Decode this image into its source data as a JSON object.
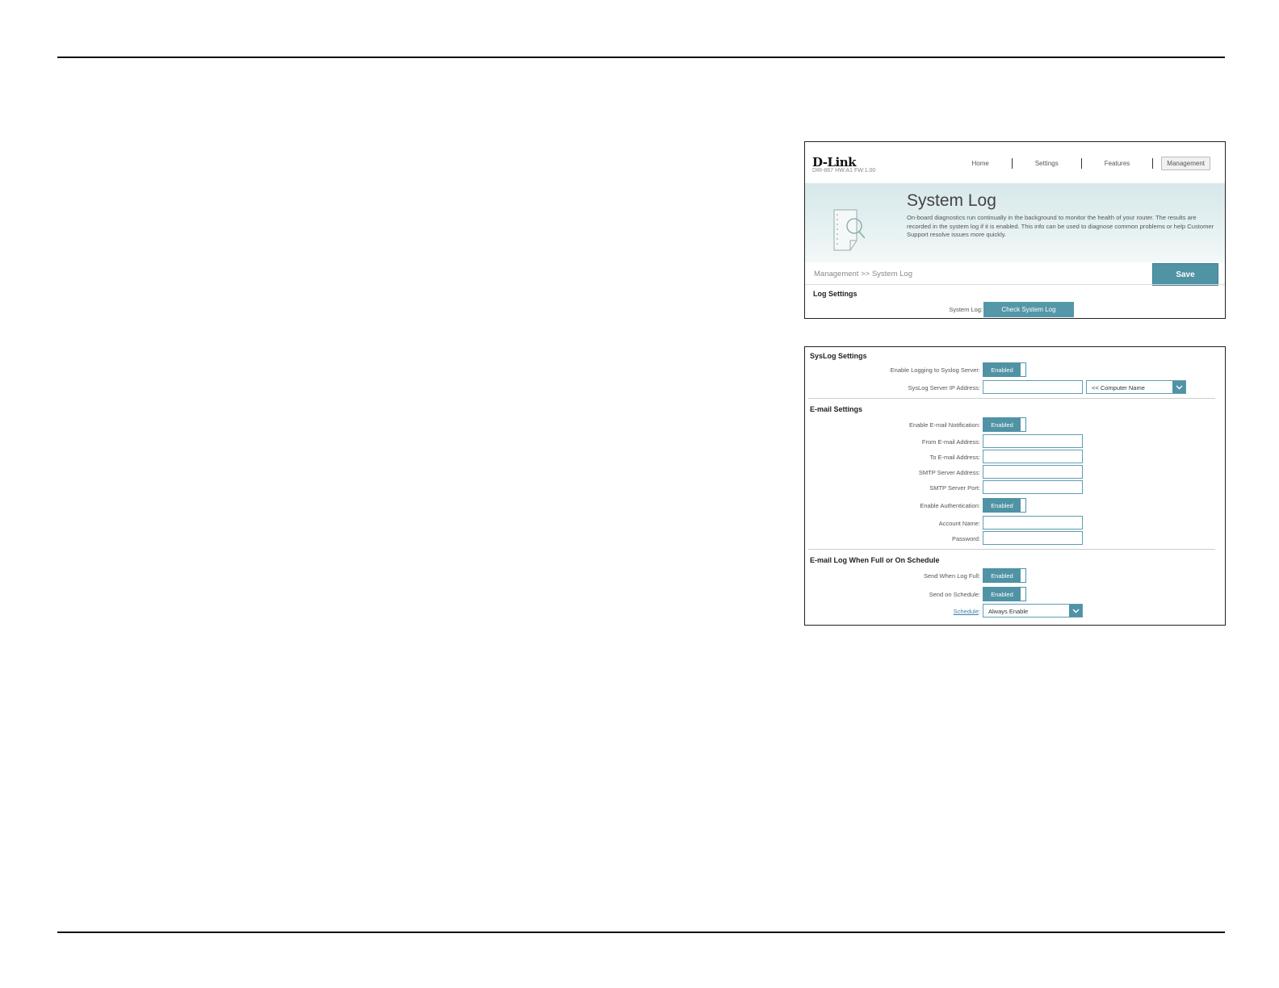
{
  "header": {
    "logo": "D-Link",
    "model": "DIR-867 HW:A1 FW:1.00",
    "nav": [
      "Home",
      "Settings",
      "Features",
      "Management"
    ],
    "active_nav": "Management"
  },
  "banner": {
    "title": "System Log",
    "description": "On-board diagnostics run continually in the background to monitor the health of your router. The results are recorded in the system log if it is enabled. This info can be used to diagnose common problems or help Customer Support resolve issues more quickly."
  },
  "breadcrumb": "Management >> System Log",
  "save_label": "Save",
  "log_settings": {
    "heading": "Log Settings",
    "system_log_label": "System Log:",
    "check_button": "Check System Log"
  },
  "syslog": {
    "heading": "SysLog Settings",
    "enable_label": "Enable Logging to Syslog Server:",
    "enable_value": "Enabled",
    "ip_label": "SysLog Server IP Address:",
    "ip_value": "",
    "computer_select": "<< Computer Name"
  },
  "email": {
    "heading": "E-mail Settings",
    "enable_label": "Enable E-mail Notification:",
    "enable_value": "Enabled",
    "from_label": "From E-mail Address:",
    "to_label": "To E-mail Address:",
    "smtp_addr_label": "SMTP Server Address:",
    "smtp_port_label": "SMTP Server Port:",
    "auth_label": "Enable Authentication:",
    "auth_value": "Enabled",
    "account_label": "Account Name:",
    "password_label": "Password:"
  },
  "schedule": {
    "heading": "E-mail Log When Full or On Schedule",
    "full_label": "Send When Log Full:",
    "full_value": "Enabled",
    "on_schedule_label": "Send on Schedule:",
    "on_schedule_value": "Enabled",
    "schedule_label": "Schedule",
    "schedule_colon": ":",
    "schedule_value": "Always Enable"
  },
  "colors": {
    "accent": "#4f93a5",
    "banner": "#d7e8eb"
  }
}
